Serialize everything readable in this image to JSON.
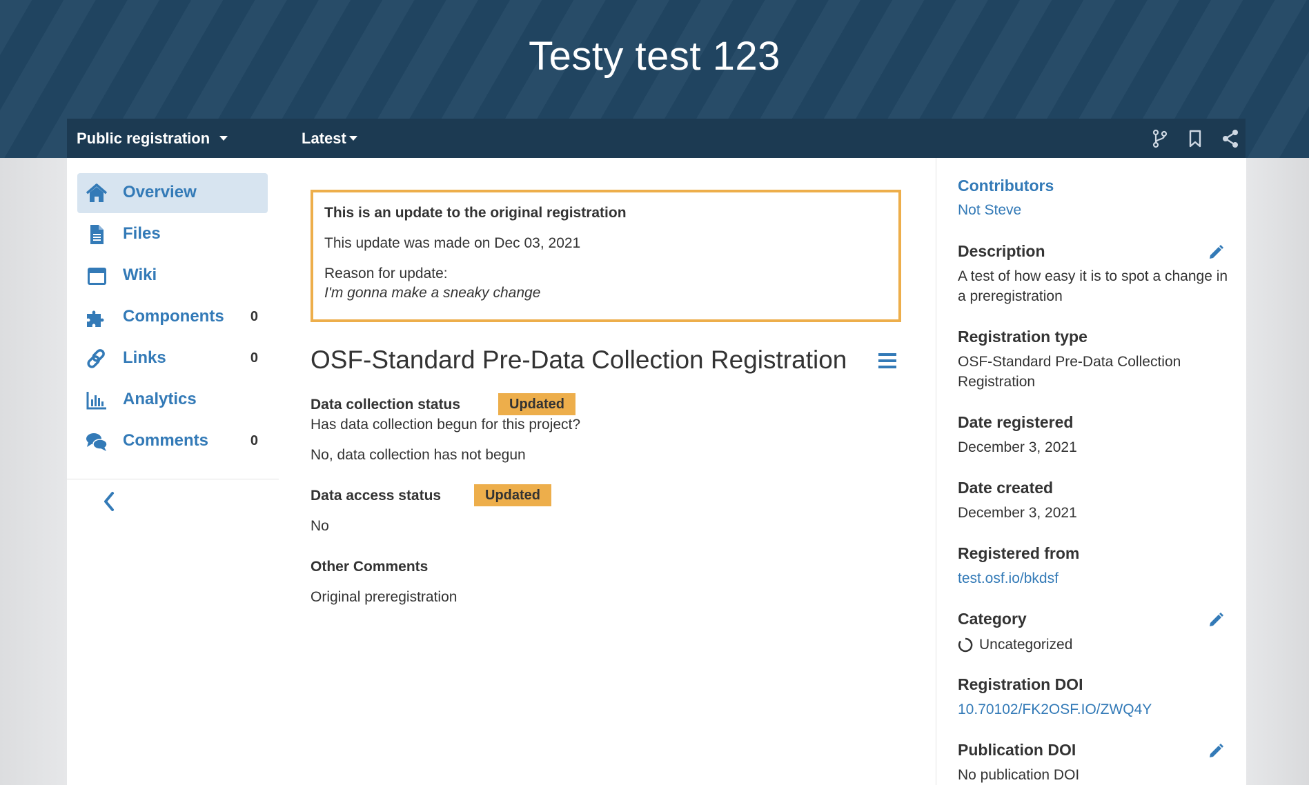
{
  "header": {
    "title": "Testy test 123"
  },
  "navbar": {
    "registration_menu": "Public registration",
    "version_menu": "Latest",
    "icons": [
      "fork-icon",
      "bookmark-icon",
      "share-icon"
    ]
  },
  "sidebar": {
    "items": [
      {
        "label": "Overview",
        "icon": "home-icon",
        "count": ""
      },
      {
        "label": "Files",
        "icon": "file-icon",
        "count": ""
      },
      {
        "label": "Wiki",
        "icon": "wiki-icon",
        "count": ""
      },
      {
        "label": "Components",
        "icon": "puzzle-icon",
        "count": "0"
      },
      {
        "label": "Links",
        "icon": "link-icon",
        "count": "0"
      },
      {
        "label": "Analytics",
        "icon": "bar-chart-icon",
        "count": ""
      },
      {
        "label": "Comments",
        "icon": "comments-icon",
        "count": "0"
      }
    ]
  },
  "update_notice": {
    "title": "This is an update to the original registration",
    "date_text": "This update was made on Dec 03, 2021",
    "reason_label": "Reason for update:",
    "reason": "I'm gonna make a sneaky change"
  },
  "schema": {
    "title": "OSF-Standard Pre-Data Collection Registration",
    "questions": [
      {
        "label": "Data collection status",
        "badge": "Updated",
        "question": "Has data collection begun for this project?",
        "answer": "No, data collection has not begun"
      },
      {
        "label": "Data access status",
        "badge": "Updated",
        "answer": "No"
      },
      {
        "label": "Other Comments",
        "answer": "Original preregistration"
      }
    ]
  },
  "details": {
    "contributors_label": "Contributors",
    "contributors": "Not Steve",
    "description_label": "Description",
    "description": "A test of how easy it is to spot a change in a preregistration",
    "registration_type_label": "Registration type",
    "registration_type": "OSF-Standard Pre-Data Collection Registration",
    "date_registered_label": "Date registered",
    "date_registered": "December 3, 2021",
    "date_created_label": "Date created",
    "date_created": "December 3, 2021",
    "registered_from_label": "Registered from",
    "registered_from": "test.osf.io/bkdsf",
    "category_label": "Category",
    "category": "Uncategorized",
    "registration_doi_label": "Registration DOI",
    "registration_doi": "10.70102/FK2OSF.IO/ZWQ4Y",
    "publication_doi_label": "Publication DOI",
    "publication_doi": "No publication DOI"
  },
  "colors": {
    "brand": "#214663",
    "link": "#337ab7",
    "badge": "#edae4b"
  }
}
